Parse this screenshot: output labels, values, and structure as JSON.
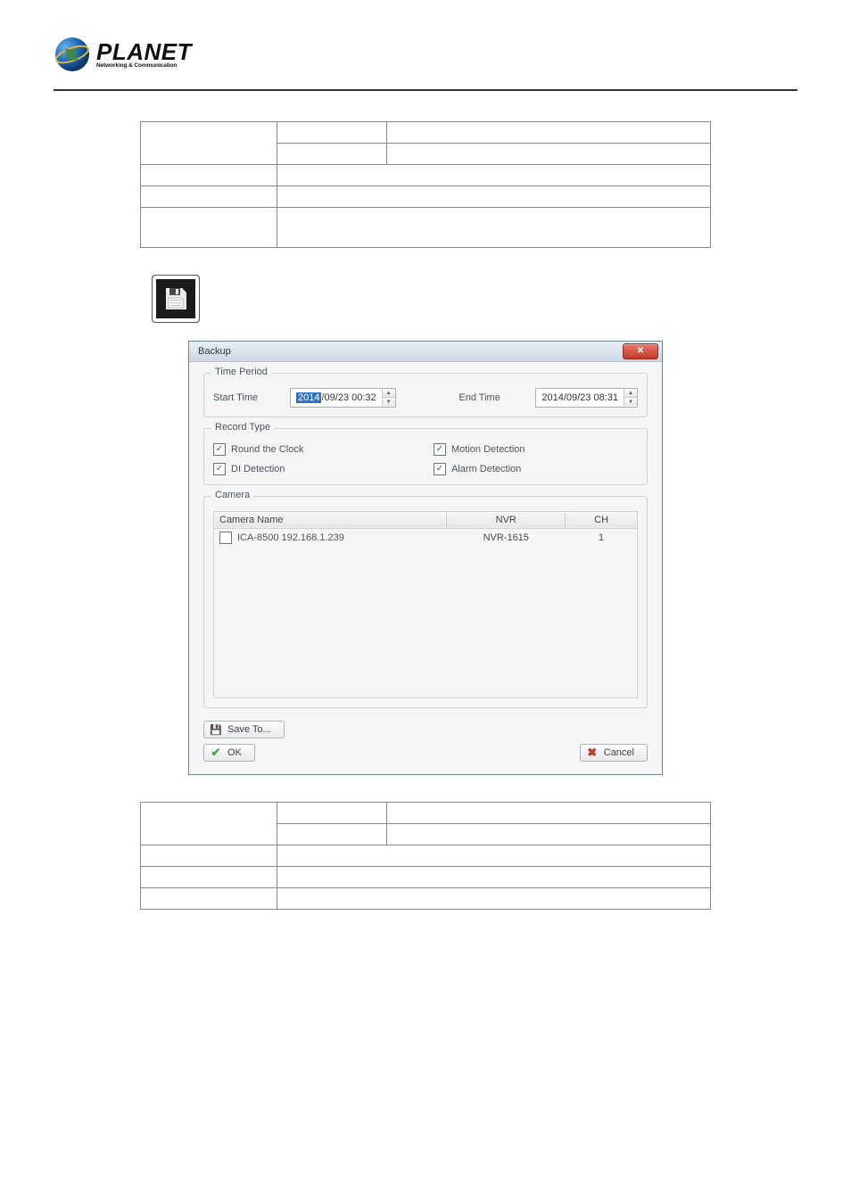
{
  "brand": {
    "name": "PLANET",
    "tagline": "Networking & Communication"
  },
  "dialog": {
    "title": "Backup",
    "close_glyph": "✕",
    "time_period": {
      "legend": "Time Period",
      "start_label": "Start Time",
      "start_year": "2014",
      "start_rest": "/09/23 00:32",
      "end_label": "End Time",
      "end_value": "2014/09/23 08:31"
    },
    "record_type": {
      "legend": "Record Type",
      "items": [
        {
          "label": "Round the Clock",
          "checked": true
        },
        {
          "label": "Motion Detection",
          "checked": true
        },
        {
          "label": "DI Detection",
          "checked": true
        },
        {
          "label": "Alarm Detection",
          "checked": true
        }
      ]
    },
    "camera": {
      "legend": "Camera",
      "headers": [
        "Camera Name",
        "NVR",
        "CH"
      ],
      "rows": [
        {
          "name": "ICA-8500 192.168.1.239",
          "nvr": "NVR-1615",
          "ch": "1",
          "checked": false
        }
      ]
    },
    "buttons": {
      "save_to": "Save To...",
      "ok": "OK",
      "cancel": "Cancel"
    }
  }
}
